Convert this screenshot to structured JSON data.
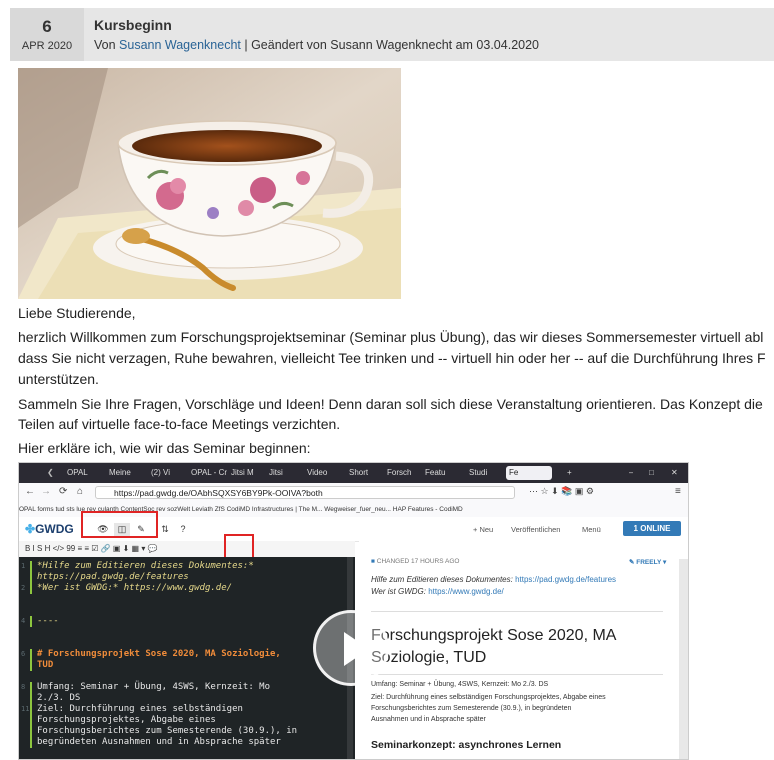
{
  "post": {
    "day": "6",
    "month_year": "APR 2020",
    "title": "Kursbeginn",
    "meta_prefix": "Von ",
    "author": "Susann Wagenknecht",
    "meta_suffix": " | Geändert von Susann Wagenknecht am 03.04.2020"
  },
  "body": {
    "greeting": "Liebe Studierende,",
    "para1_line1": "herzlich Willkommen zum Forschungsprojektseminar (Seminar plus Übung), das wir dieses Sommersemester virtuell abl",
    "para1_line2": "dass Sie nicht verzagen, Ruhe bewahren, vielleicht Tee trinken und -- virtuell hin oder her -- auf die Durchführung Ihres F",
    "para1_line3": "unterstützen.",
    "para2_line1": "Sammeln Sie Ihre Fragen, Vorschläge und Ideen! Denn daran soll sich diese Veranstaltung orientieren. Das Konzept die",
    "para2_line2": "Teilen auf virtuelle face-to-face Meetings verzichten.",
    "para3": "Hier erkläre ich, wie wir das Seminar beginnen:"
  },
  "screenshot": {
    "tabs": [
      "OPAL",
      "Meine",
      "(2) Vi",
      "OPAL - Cr",
      "Jitsi M",
      "Jitsi",
      "Video",
      "Short",
      "Forsch",
      "Featu",
      "Studi",
      "Fe"
    ],
    "url": "https://pad.gwdg.de/OAbhSQXSY6BY9Pk-OOIVA?both",
    "bookmarks": "OPAL   forms tud   sts lue rev   culanth   ContentSoc rev   sozWelt   Leviath   ZfS   CodiMD   Infrastructures | The M...   Wegweiser_fuer_neu...   HAP   Features - CodiMD",
    "logo": "GWDG",
    "toolbar_new": "+ Neu",
    "toolbar_publish": "Veröffentlichen",
    "toolbar_menu": "Menü",
    "online_label": "1 ONLINE",
    "format_bar": "B  I  S  H  </>  99  ≡  ≡  ☑  🔗  ▣  ⬇  ▦  ▾  💬",
    "editor_lines": [
      {
        "no": "1",
        "text": "*Hilfe zum Editieren dieses Dokumentes:*",
        "color": "#e6d98b"
      },
      {
        "no": "",
        "text": "https://pad.gwdg.de/features",
        "color": "#e6d98b"
      },
      {
        "no": "2",
        "text": "*Wer ist GWDG:* https://www.gwdg.de/",
        "color": "#e6d98b"
      },
      {
        "no": "4",
        "text": "----",
        "color": "#e6d98b"
      },
      {
        "no": "6",
        "text": "# Forschungsprojekt Sose 2020, MA Soziologie,",
        "color": "#f08c3a"
      },
      {
        "no": "",
        "text": "TUD",
        "color": "#f08c3a"
      },
      {
        "no": "8",
        "text": "Umfang: Seminar + Übung, 4SWS, Kernzeit: Mo",
        "color": "#e8e8e8"
      },
      {
        "no": "",
        "text": "2./3. DS",
        "color": "#e8e8e8"
      },
      {
        "no": "11",
        "text": "Ziel: Durchführung eines selbständigen",
        "color": "#e8e8e8"
      },
      {
        "no": "",
        "text": "Forschungsprojektes, Abgabe eines",
        "color": "#e8e8e8"
      },
      {
        "no": "",
        "text": "Forschungsberichtes zum Semesterende (30.9.), in",
        "color": "#e8e8e8"
      },
      {
        "no": "",
        "text": "begründeten Ausnahmen und in Absprache später",
        "color": "#e8e8e8"
      }
    ],
    "preview": {
      "changed": "CHANGED 17 HOURS AGO",
      "freely": "FREELY",
      "help_label": "Hilfe zum Editieren dieses Dokumentes: ",
      "help_link": "https://pad.gwdg.de/features",
      "gwdg_label": "Wer ist GWDG: ",
      "gwdg_link": "https://www.gwdg.de/",
      "heading_line1": "Forschungsprojekt Sose 2020, MA",
      "heading_line2": "Soziologie, TUD",
      "umfang": "Umfang: Seminar + Übung, 4SWS, Kernzeit: Mo 2./3. DS",
      "ziel_line1": "Ziel: Durchführung eines selbständigen Forschungsprojektes, Abgabe eines",
      "ziel_line2": "Forschungsberichtes zum Semesterende (30.9.), in begründeten",
      "ziel_line3": "Ausnahmen und in Absprache später",
      "subheading": "Seminarkonzept: asynchrones Lernen"
    }
  }
}
